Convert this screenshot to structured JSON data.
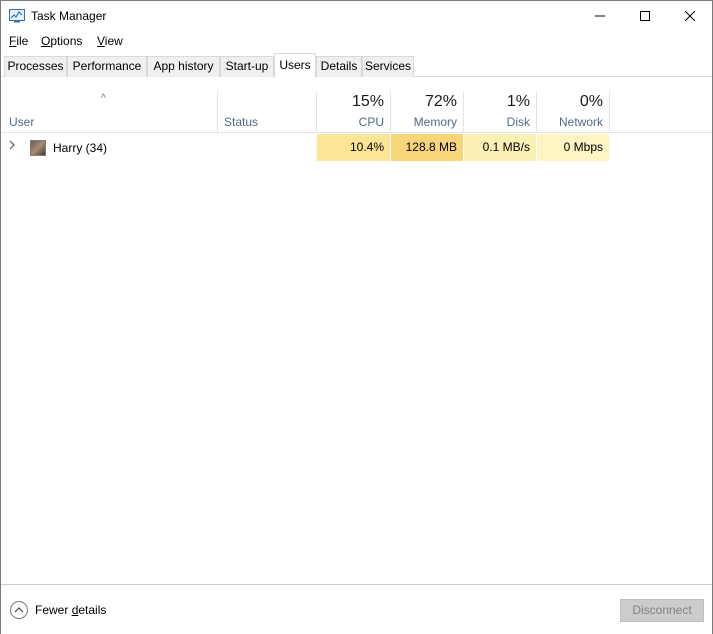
{
  "window": {
    "title": "Task Manager"
  },
  "menu": [
    {
      "label": "File",
      "accel": "F",
      "rest": "ile"
    },
    {
      "label": "Options",
      "accel": "O",
      "rest": "ptions"
    },
    {
      "label": "View",
      "accel": "V",
      "rest": "iew"
    }
  ],
  "tabs": [
    "Processes",
    "Performance",
    "App history",
    "Start-up",
    "Users",
    "Details",
    "Services"
  ],
  "active_tab": "Users",
  "columns": {
    "user": "User",
    "status": "Status",
    "cpu": {
      "pct": "15%",
      "name": "CPU"
    },
    "memory": {
      "pct": "72%",
      "name": "Memory"
    },
    "disk": {
      "pct": "1%",
      "name": "Disk"
    },
    "network": {
      "pct": "0%",
      "name": "Network"
    }
  },
  "rows": [
    {
      "user": "Harry (34)",
      "status": "",
      "cpu": "10.4%",
      "memory": "128.8 MB",
      "disk": "0.1 MB/s",
      "network": "0 Mbps"
    }
  ],
  "heat_colors": {
    "cpu": "#fde597",
    "memory": "#f9d57a",
    "disk": "#fdf0b4",
    "network": "#fff4c4"
  },
  "footer": {
    "fewer_details": "Fewer details",
    "fewer_accel": "d",
    "disconnect": "Disconnect"
  },
  "icons": {
    "app": "task-manager-icon",
    "fewer": "chevron-up-circle-icon",
    "expand": "chevron-right-icon",
    "sort": "sort-ascending-icon"
  }
}
